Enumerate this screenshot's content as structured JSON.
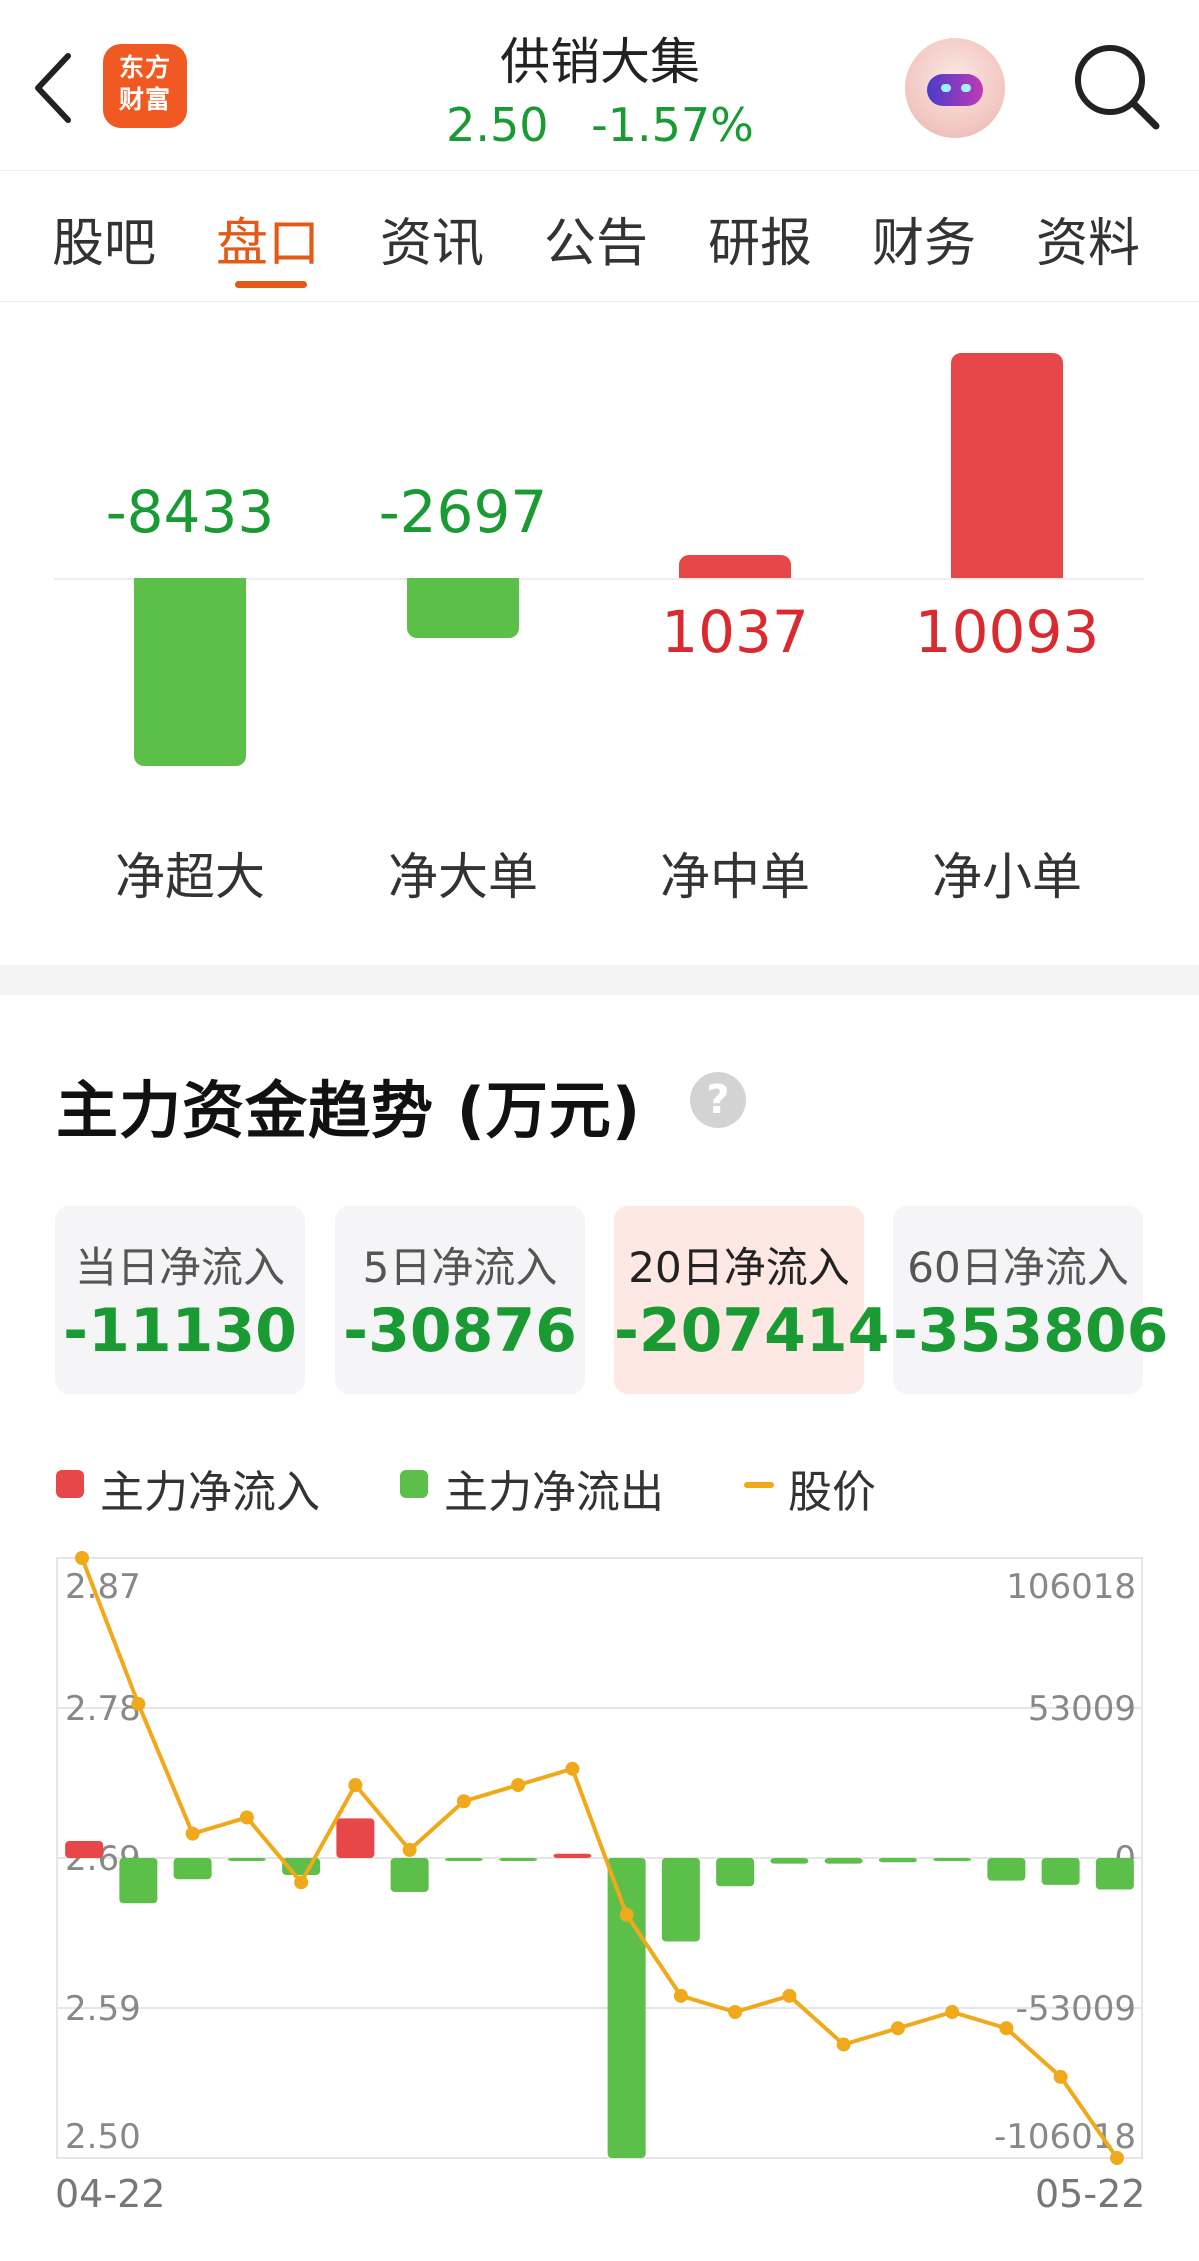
{
  "header": {
    "logo_line1": "东方",
    "logo_line2": "财富",
    "stock_name": "供销大集",
    "price": "2.50",
    "change_pct": "-1.57%"
  },
  "tabs": [
    "股吧",
    "盘口",
    "资讯",
    "公告",
    "研报",
    "财务",
    "资料"
  ],
  "active_tab": "盘口",
  "net_flow": {
    "items": [
      {
        "label": "净超大",
        "value": "-8433",
        "num": -8433
      },
      {
        "label": "净大单",
        "value": "-2697",
        "num": -2697
      },
      {
        "label": "净中单",
        "value": "1037",
        "num": 1037
      },
      {
        "label": "净小单",
        "value": "10093",
        "num": 10093
      }
    ],
    "colors": {
      "positive": "#e8474a",
      "negative": "#5cbf4a",
      "positive_text": "#d92b2f",
      "negative_text": "#1a9a32"
    }
  },
  "trend": {
    "title": "主力资金趋势 (万元)",
    "help_symbol": "?",
    "cards": [
      {
        "label": "当日净流入",
        "value": "-11130"
      },
      {
        "label": "5日净流入",
        "value": "-30876"
      },
      {
        "label": "20日净流入",
        "value": "-207414"
      },
      {
        "label": "60日净流入",
        "value": "-353806"
      }
    ],
    "active_card": 2,
    "legend": {
      "inflow": "主力净流入",
      "outflow": "主力净流出",
      "price": "股价"
    }
  },
  "chart_data": {
    "type": "bar",
    "title": "",
    "left_axis_ticks": [
      "2.87",
      "2.78",
      "2.69",
      "2.59",
      "2.50"
    ],
    "right_axis_ticks": [
      "106018",
      "53009",
      "0",
      "-53009",
      "-106018"
    ],
    "price_range": [
      2.5,
      2.87
    ],
    "flow_range": [
      -106018,
      106018
    ],
    "x_start_label": "04-22",
    "x_end_label": "05-22",
    "series": [
      {
        "name": "主力净流入/主力净流出",
        "values": [
          6000,
          -16000,
          -7500,
          -600,
          -6000,
          14000,
          -12000,
          -600,
          -600,
          1500,
          -106000,
          -29500,
          -10000,
          -2000,
          -2000,
          -1500,
          -500,
          -8000,
          -9500,
          -11130
        ]
      },
      {
        "name": "股价",
        "values": [
          2.87,
          2.78,
          2.7,
          2.71,
          2.67,
          2.73,
          2.69,
          2.72,
          2.73,
          2.74,
          2.65,
          2.6,
          2.59,
          2.6,
          2.57,
          2.58,
          2.59,
          2.58,
          2.55,
          2.5
        ]
      }
    ],
    "colors": {
      "inflow": "#e8474a",
      "outflow": "#5cbf4a",
      "price": "#f0a91a",
      "grid": "#e6e6e6",
      "axis_text": "#888888"
    }
  }
}
